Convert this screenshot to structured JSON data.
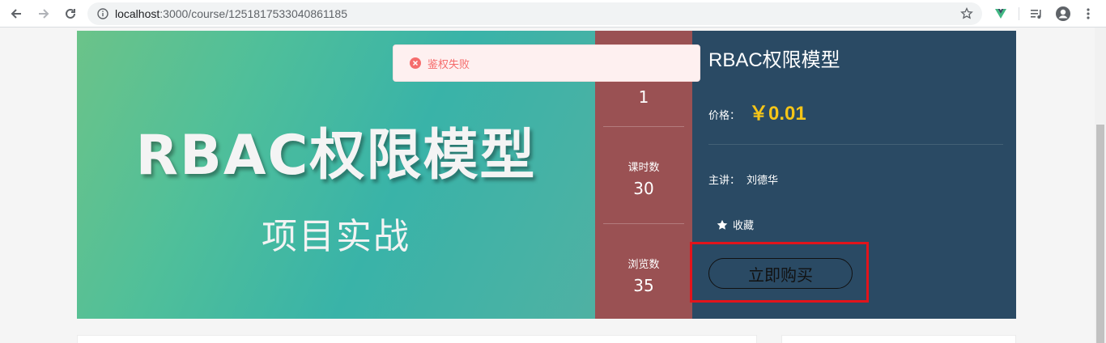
{
  "browser": {
    "url_host": "localhost",
    "url_path": ":3000/course/1251817533040861185"
  },
  "toast": {
    "message": "鉴权失败",
    "color": "#f56c6c"
  },
  "banner": {
    "title_art": "RBAC权限模型",
    "subtitle_art": "项目实战"
  },
  "stats": [
    {
      "label": "",
      "value": "1"
    },
    {
      "label": "课时数",
      "value": "30"
    },
    {
      "label": "浏览数",
      "value": "35"
    }
  ],
  "course": {
    "title": "RBAC权限模型",
    "price_label": "价格：",
    "price": "￥0.01",
    "teacher_label": "主讲：",
    "teacher_name": "刘德华",
    "favorite_label": "收藏",
    "buy_label": "立即购买"
  },
  "colors": {
    "stats_bg": "#9a5153",
    "panel_bg": "#2a4a64",
    "price": "#f5c518",
    "highlight": "#e2141b"
  }
}
